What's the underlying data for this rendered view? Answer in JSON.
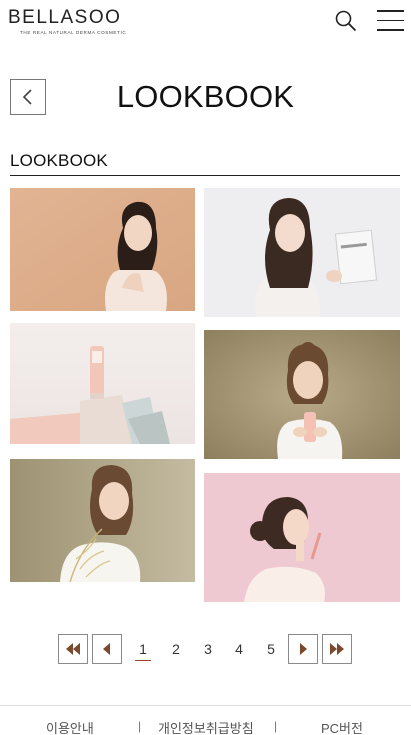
{
  "header": {
    "logo_text": "BELLASOO",
    "logo_tagline": "THE REAL NATURAL DERMA COSMETIC",
    "search_icon": "search-icon",
    "menu_icon": "hamburger-menu-icon"
  },
  "page": {
    "title": "LOOKBOOK",
    "back_icon": "chevron-left-icon"
  },
  "section": {
    "title": "LOOKBOOK"
  },
  "lookbook": {
    "items": [
      {
        "name": "lookbook-photo-1"
      },
      {
        "name": "lookbook-photo-2"
      },
      {
        "name": "lookbook-photo-3"
      },
      {
        "name": "lookbook-photo-4"
      },
      {
        "name": "lookbook-photo-5"
      },
      {
        "name": "lookbook-photo-6"
      }
    ]
  },
  "pagination": {
    "first_icon": "double-chevron-left-icon",
    "prev_icon": "chevron-left-icon",
    "next_icon": "chevron-right-icon",
    "last_icon": "double-chevron-right-icon",
    "pages": [
      "1",
      "2",
      "3",
      "4",
      "5"
    ],
    "current_page": "1"
  },
  "footer": {
    "links": [
      "이용안내",
      "개인정보취급방침",
      "PC버전"
    ],
    "separator": "|"
  }
}
